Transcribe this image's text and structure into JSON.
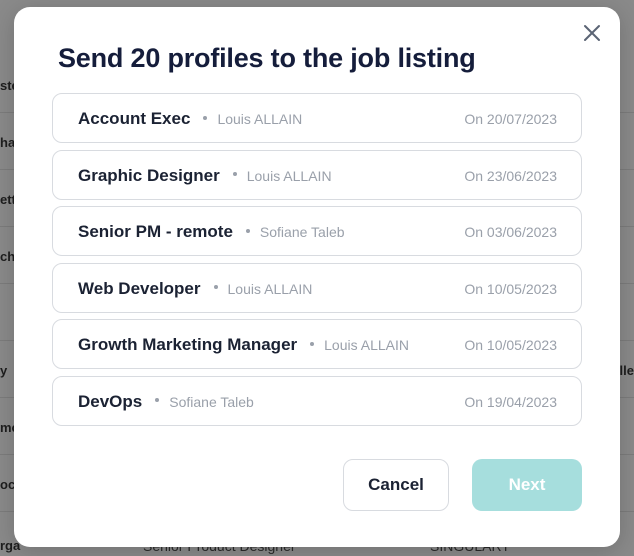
{
  "background": {
    "left_fragments": [
      "ste",
      "ha",
      "ett",
      "ch",
      "y",
      "mo",
      "oc",
      "rga"
    ],
    "right_fragments": [
      "lle"
    ],
    "bottom_fragments": [
      "Senior Product Designer",
      "SINGULART"
    ]
  },
  "modal": {
    "title": "Send 20 profiles to the job listing",
    "close_icon": "close-icon",
    "jobs": [
      {
        "title": "Account Exec",
        "owner": "Louis ALLAIN",
        "date": "On 20/07/2023"
      },
      {
        "title": "Graphic Designer",
        "owner": "Louis ALLAIN",
        "date": "On 23/06/2023"
      },
      {
        "title": "Senior PM - remote",
        "owner": "Sofiane Taleb",
        "date": "On 03/06/2023"
      },
      {
        "title": "Web Developer",
        "owner": "Louis ALLAIN",
        "date": "On 10/05/2023"
      },
      {
        "title": "Growth Marketing Manager",
        "owner": "Louis ALLAIN",
        "date": "On 10/05/2023"
      },
      {
        "title": "DevOps",
        "owner": "Sofiane Taleb",
        "date": "On 19/04/2023"
      }
    ],
    "cancel_label": "Cancel",
    "next_label": "Next"
  },
  "colors": {
    "backdrop": "#8a8a8a",
    "title": "#151d3b",
    "muted_text": "#9aa0aa",
    "next_button_disabled": "#a6dedd",
    "card_border": "#d8dbe0"
  }
}
